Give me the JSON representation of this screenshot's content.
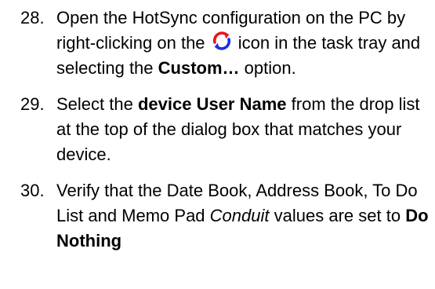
{
  "steps": [
    {
      "number": "28.",
      "part1": "Open the HotSync configuration on the PC by right-clicking on the",
      "part2": "icon in the task tray and selecting the",
      "bold": "Custom…",
      "part3": "option.",
      "icon": "hotsync-icon"
    },
    {
      "number": "29.",
      "part1": "Select the",
      "bold": "device User Name",
      "part2": "from the drop list at the top of the dialog box that matches your device."
    },
    {
      "number": "30.",
      "part1": "Verify that the Date Book, Address Book, To Do List and Memo Pad",
      "italic": "Conduit",
      "part2": "values are set to",
      "bold": "Do Nothing"
    }
  ],
  "colors": {
    "hotsync_red": "#e8161c",
    "hotsync_blue": "#1b2ee0"
  }
}
